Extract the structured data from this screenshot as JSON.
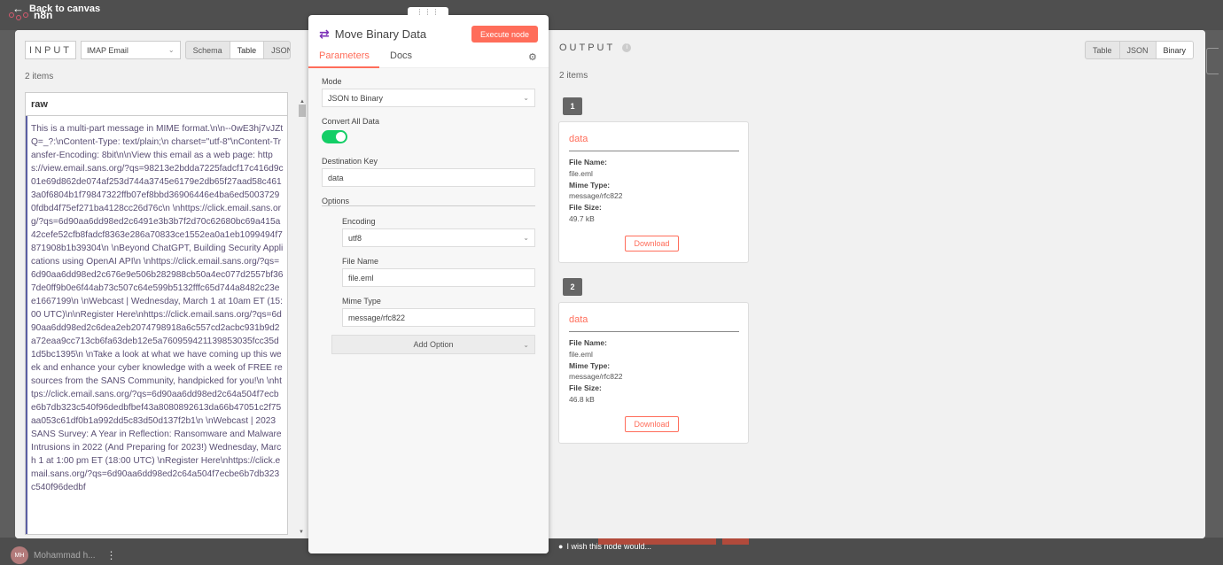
{
  "background": {
    "back_label": "Back to canvas",
    "logo_text": "n8n",
    "user_initials": "MH",
    "user_name": "Mohammad h...",
    "feedback_text": "I wish this node would..."
  },
  "input": {
    "label": "INPUT",
    "node_select": "IMAP Email",
    "views": [
      "Schema",
      "Table",
      "JSON"
    ],
    "active_view": "Table",
    "count": "2 items",
    "column": "raw",
    "raw_text": "This is a multi-part message in MIME format.\\n\\n--0wE3hj7vJZtQ=_?:\\nContent-Type: text/plain;\\n charset=\"utf-8\"\\nContent-Transfer-Encoding: 8bit\\n\\nView this email as a web page: https://view.email.sans.org/?qs=98213e2bdda7225fadcf17c416d9c01e69d862de074af253d744a3745e6179e2db65f27aad58c4613a0f6804b1f79847322ffb07ef8bbd36906446e4ba6ed50037290fdbd4f75ef271ba4128cc26d76c\\n \\nhttps://click.email.sans.org/?qs=6d90aa6dd98ed2c6491e3b3b7f2d70c62680bc69a415a42cefe52cfb8fadcf8363e286a70833ce1552ea0a1eb1099494f7871908b1b39304\\n \\nBeyond ChatGPT, Building Security Applications using OpenAI API\\n \\nhttps://click.email.sans.org/?qs=6d90aa6dd98ed2c676e9e506b282988cb50a4ec077d2557bf367de0ff9b0e6f44ab73c507c64e599b5132fffc65d744a8482c23ee1667199\\n \\nWebcast | Wednesday, March 1 at 10am ET (15:00 UTC)\\n\\nRegister Here\\nhttps://click.email.sans.org/?qs=6d90aa6dd98ed2c6dea2eb2074798918a6c557cd2acbc931b9d2a72eaa9cc713cb6fa63deb12e5a760959421139853035fcc35d1d5bc1395\\n \\nTake a look at what we have coming up this week and enhance your cyber knowledge with a week of FREE resources from the SANS Community, handpicked for you!\\n \\nhttps://click.email.sans.org/?qs=6d90aa6dd98ed2c64a504f7ecbe6b7db323c540f96dedbfbef43a8080892613da66b47051c2f75aa053c61df0b1a992dd5c83d50d137f2b1\\n \\nWebcast  | 2023 SANS Survey: A Year in Reflection: Ransomware and Malware Intrusions in 2022 (And Preparing for 2023!) Wednesday, March 1 at 1:00 pm ET (18:00 UTC) \\nRegister Here\\nhttps://click.email.sans.org/?qs=6d90aa6dd98ed2c64a504f7ecbe6b7db323c540f96dedbf"
  },
  "node": {
    "title": "Move Binary Data",
    "execute_label": "Execute node",
    "tabs": [
      "Parameters",
      "Docs"
    ],
    "mode_label": "Mode",
    "mode_value": "JSON to Binary",
    "convert_label": "Convert All Data",
    "convert_enabled": true,
    "dest_key_label": "Destination Key",
    "dest_key_value": "data",
    "options_label": "Options",
    "encoding_label": "Encoding",
    "encoding_value": "utf8",
    "file_name_label": "File Name",
    "file_name_value": "file.eml",
    "mime_label": "Mime Type",
    "mime_value": "message/rfc822",
    "add_option_label": "Add Option"
  },
  "output": {
    "label": "OUTPUT",
    "views": [
      "Table",
      "JSON",
      "Binary"
    ],
    "active_view": "Binary",
    "count": "2 items",
    "items": [
      {
        "index": "1",
        "name": "data",
        "file_name_label": "File Name:",
        "file_name": "file.eml",
        "mime_label": "Mime Type:",
        "mime": "message/rfc822",
        "size_label": "File Size:",
        "size": "49.7 kB",
        "download": "Download"
      },
      {
        "index": "2",
        "name": "data",
        "file_name_label": "File Name:",
        "file_name": "file.eml",
        "mime_label": "Mime Type:",
        "mime": "message/rfc822",
        "size_label": "File Size:",
        "size": "46.8 kB",
        "download": "Download"
      }
    ]
  },
  "colors": {
    "accent": "#ff6d5a",
    "toggle_on": "#13ce66",
    "node_icon": "#7b2fb7"
  }
}
